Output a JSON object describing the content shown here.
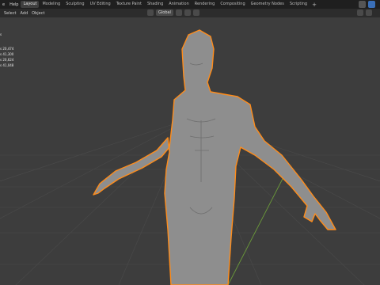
{
  "topbar": {
    "menu": [
      "e",
      "Help"
    ],
    "tabs": [
      {
        "label": "Layout",
        "active": true
      },
      {
        "label": "Modeling",
        "active": false
      },
      {
        "label": "Sculpting",
        "active": false
      },
      {
        "label": "UV Editing",
        "active": false
      },
      {
        "label": "Texture Paint",
        "active": false
      },
      {
        "label": "Shading",
        "active": false
      },
      {
        "label": "Animation",
        "active": false
      },
      {
        "label": "Rendering",
        "active": false
      },
      {
        "label": "Compositing",
        "active": false
      },
      {
        "label": "Geometry Nodes",
        "active": false
      },
      {
        "label": "Scripting",
        "active": false
      }
    ],
    "add_tab": "+"
  },
  "header": {
    "menu": [
      "Select",
      "Add",
      "Object"
    ],
    "orientation": "Global"
  },
  "stats": {
    "head": "s",
    "lines": [
      "s  20,474",
      "s  41,300",
      "s  20,624",
      "s  41,048"
    ]
  },
  "colors": {
    "selection_outline": "#ff8c1a",
    "mesh": "#8e8e8e",
    "grid": "#4a4a4a",
    "y_axis": "#6b9a3a",
    "bg": "#3d3d3d"
  }
}
